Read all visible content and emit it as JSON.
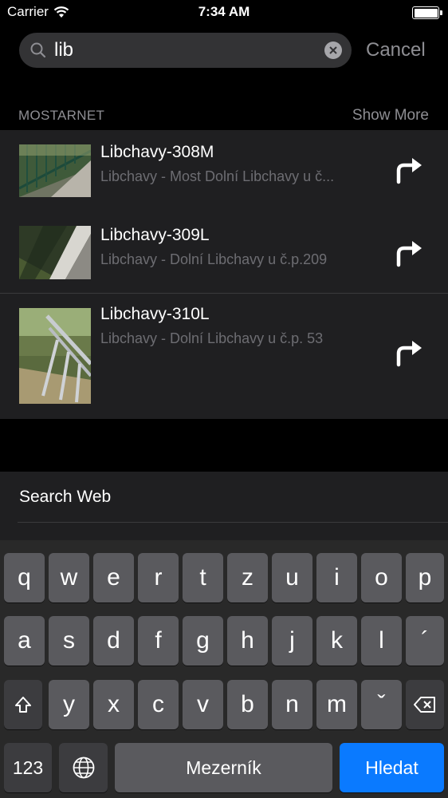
{
  "status": {
    "carrier": "Carrier",
    "time": "7:34 AM",
    "battery_level": 1.0
  },
  "search": {
    "query": "lib",
    "cancel_label": "Cancel"
  },
  "section": {
    "title": "MOSTARNET",
    "show_more_label": "Show More"
  },
  "results": [
    {
      "title": "Libchavy-308M",
      "subtitle": "Libchavy - Most Dolní Libchavy u č..."
    },
    {
      "title": "Libchavy-309L",
      "subtitle": "Libchavy - Dolní Libchavy u č.p.209"
    },
    {
      "title": "Libchavy-310L",
      "subtitle": "Libchavy - Dolní Libchavy u č.p. 53"
    }
  ],
  "web": {
    "label": "Search Web"
  },
  "keyboard": {
    "row1": [
      "q",
      "w",
      "e",
      "r",
      "t",
      "z",
      "u",
      "i",
      "o",
      "p"
    ],
    "row2": [
      "a",
      "s",
      "d",
      "f",
      "g",
      "h",
      "j",
      "k",
      "l",
      "´"
    ],
    "row3": [
      "y",
      "x",
      "c",
      "v",
      "b",
      "n",
      "m",
      "ˇ"
    ],
    "numbers_label": "123",
    "space_label": "Mezerník",
    "go_label": "Hledat"
  },
  "colors": {
    "accent": "#0a7aff",
    "panel": "#1f1f21",
    "secondary_text": "#8e8e93"
  }
}
